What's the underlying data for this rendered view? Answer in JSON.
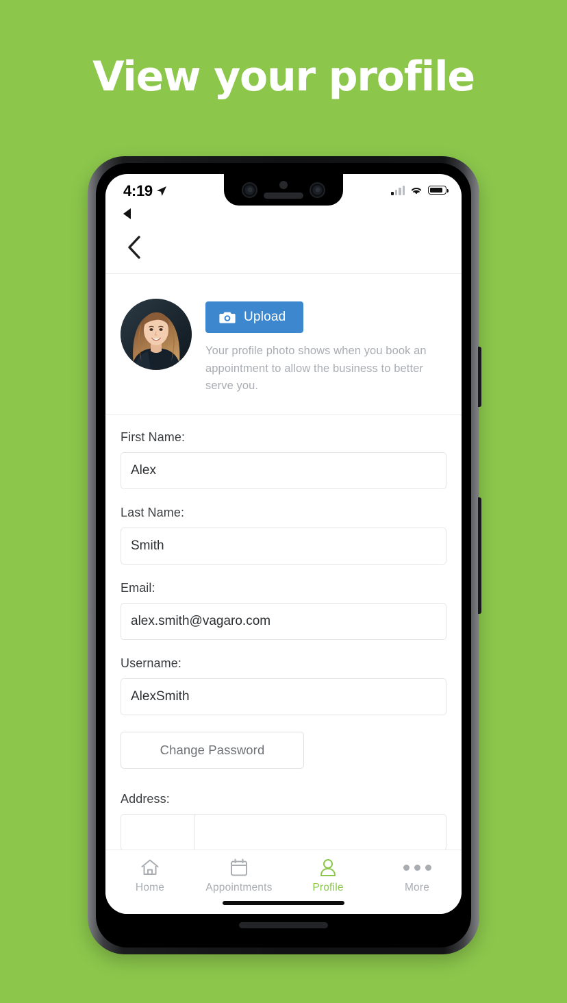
{
  "hero": {
    "title": "View your profile",
    "background_color": "#8cc74c",
    "text_color": "#ffffff"
  },
  "status_bar": {
    "time": "4:19",
    "location_icon": "location-arrow-icon",
    "back_to_app_icon": "back-to-app-triangle-icon",
    "signal_icon": "cellular-signal-icon",
    "wifi_icon": "wifi-icon",
    "battery_icon": "battery-icon"
  },
  "nav": {
    "back_icon": "chevron-left-icon"
  },
  "photo_section": {
    "avatar_alt": "profile-photo",
    "upload_label": "Upload",
    "upload_icon": "camera-icon",
    "upload_color": "#3c87ce",
    "help_text": "Your profile photo shows when you book an appointment to allow the business to better serve you."
  },
  "form": {
    "fields": [
      {
        "label": "First Name:",
        "value": "Alex",
        "placeholder": "First Name"
      },
      {
        "label": "Last Name:",
        "value": "Smith",
        "placeholder": "Last Name"
      },
      {
        "label": "Email:",
        "value": "alex.smith@vagaro.com",
        "placeholder": "Email"
      },
      {
        "label": "Username:",
        "value": "AlexSmith",
        "placeholder": "Username"
      }
    ],
    "change_password_label": "Change Password",
    "address_label": "Address:",
    "address_prefix_value": "",
    "address_prefix_placeholder": "",
    "address_value": "",
    "address_placeholder": ""
  },
  "tab_bar": {
    "active_color": "#8cc74c",
    "inactive_color": "#a9adb2",
    "items": [
      {
        "label": "Home",
        "icon": "home-icon",
        "active": false
      },
      {
        "label": "Appointments",
        "icon": "calendar-icon",
        "active": false
      },
      {
        "label": "Profile",
        "icon": "person-icon",
        "active": true
      },
      {
        "label": "More",
        "icon": "ellipsis-icon",
        "active": false
      }
    ]
  }
}
